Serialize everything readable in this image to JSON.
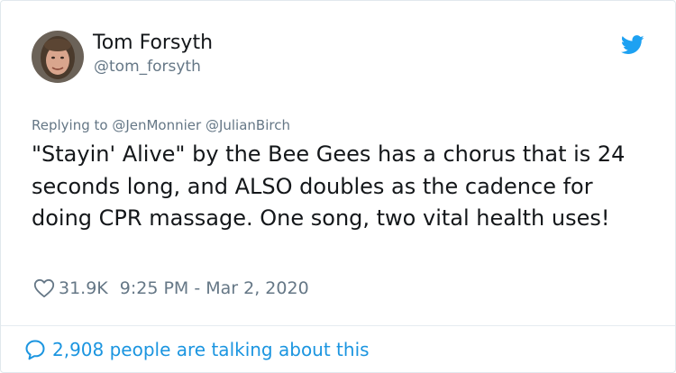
{
  "tweet": {
    "author": {
      "display_name": "Tom Forsyth",
      "handle": "@tom_forsyth",
      "avatar_icon": "profile-photo"
    },
    "brand_icon": "twitter-bird-icon",
    "brand_color": "#1da1f2",
    "replying_to": "Replying to @JenMonnier @JulianBirch",
    "text": "\"Stayin' Alive\" by the Bee Gees has a chorus that is 24 seconds long, and ALSO doubles as the cadence for doing CPR massage. One song, two vital health uses!",
    "like_count": "31.9K",
    "timestamp": "9:25 PM - Mar 2, 2020",
    "talking_text": "2,908 people are talking about this",
    "colors": {
      "text": "#14171a",
      "secondary": "#657786",
      "link": "#1b95e0"
    }
  }
}
